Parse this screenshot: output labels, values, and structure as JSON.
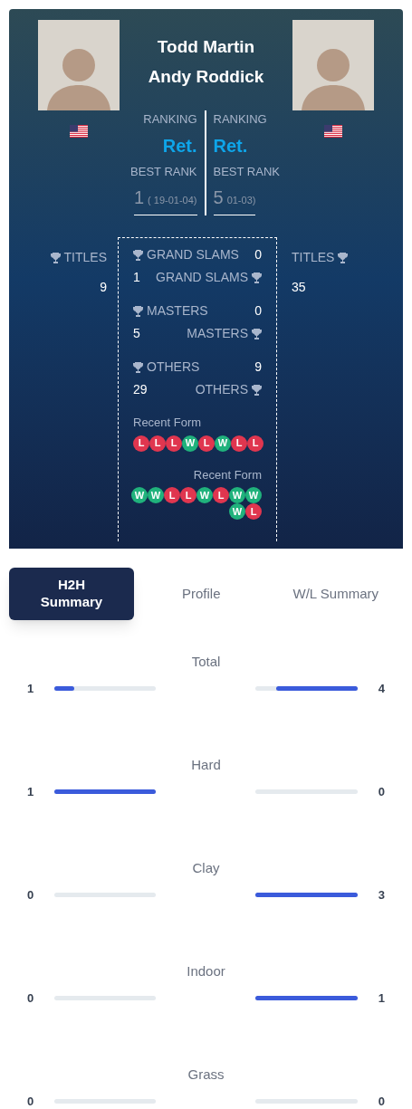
{
  "players": [
    {
      "name": "Todd Martin",
      "ranking_label": "RANKING",
      "ranking": "Ret.",
      "best_rank_label": "BEST RANK",
      "best_rank": "1",
      "best_rank_date": "( 19-01-04)",
      "titles_label": "TITLES",
      "titles": "9",
      "categories": [
        {
          "label": "GRAND SLAMS",
          "value": "0"
        },
        {
          "label": "MASTERS",
          "value": "0"
        },
        {
          "label": "OTHERS",
          "value": "9"
        }
      ],
      "recent_form_label": "Recent Form",
      "recent_form": [
        "L",
        "L",
        "L",
        "W",
        "L",
        "W",
        "L",
        "L"
      ]
    },
    {
      "name": "Andy Roddick",
      "ranking_label": "RANKING",
      "ranking": "Ret.",
      "best_rank_label": "BEST RANK",
      "best_rank": "5",
      "best_rank_date": "01-03)",
      "titles_label": "TITLES",
      "titles": "35",
      "categories": [
        {
          "label": "GRAND SLAMS",
          "value": "1"
        },
        {
          "label": "MASTERS",
          "value": "5"
        },
        {
          "label": "OTHERS",
          "value": "29"
        }
      ],
      "recent_form_label": "Recent Form",
      "recent_form": [
        "W",
        "W",
        "L",
        "L",
        "W",
        "L",
        "W",
        "W",
        "W",
        "L"
      ]
    }
  ],
  "tabs": [
    {
      "label": "H2H Summary",
      "selected": true
    },
    {
      "label": "Profile",
      "selected": false
    },
    {
      "label": "W/L Summary",
      "selected": false
    }
  ],
  "h2h": [
    {
      "label": "Total",
      "left": {
        "count": "1",
        "level": 0.2
      },
      "right": {
        "count": "4",
        "level": 0.8
      }
    },
    {
      "label": "Hard",
      "left": {
        "count": "1",
        "level": 1
      },
      "right": {
        "count": "0",
        "level": 0
      }
    },
    {
      "label": "Clay",
      "left": {
        "count": "0",
        "level": 0
      },
      "right": {
        "count": "3",
        "level": 1
      }
    },
    {
      "label": "Indoor",
      "left": {
        "count": "0",
        "level": 0
      },
      "right": {
        "count": "1",
        "level": 1
      }
    },
    {
      "label": "Grass",
      "left": {
        "count": "0",
        "level": 0
      },
      "right": {
        "count": "0",
        "level": 0
      }
    }
  ]
}
